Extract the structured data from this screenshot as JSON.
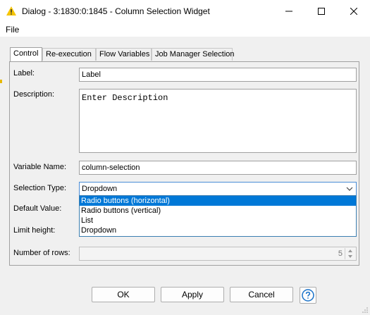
{
  "window": {
    "title": "Dialog - 3:1830:0:1845 - Column Selection Widget",
    "colors": {
      "accent": "#0078d7",
      "warning_icon": "#f5c400"
    }
  },
  "menu": {
    "file": "File"
  },
  "tabs": [
    {
      "label": "Control",
      "active": true
    },
    {
      "label": "Re-execution",
      "active": false
    },
    {
      "label": "Flow Variables",
      "active": false
    },
    {
      "label": "Job Manager Selection",
      "active": false
    }
  ],
  "form": {
    "label": {
      "label": "Label:",
      "value": "Label"
    },
    "description": {
      "label": "Description:",
      "value": "Enter Description"
    },
    "variable_name": {
      "label": "Variable Name:",
      "value": "column-selection"
    },
    "selection_type": {
      "label": "Selection Type:",
      "value": "Dropdown",
      "options": [
        "Radio buttons (horizontal)",
        "Radio buttons (vertical)",
        "List",
        "Dropdown"
      ],
      "highlighted_option": "Radio buttons (horizontal)"
    },
    "default_value": {
      "label": "Default Value:"
    },
    "limit_height": {
      "label": "Limit height:"
    },
    "number_of_rows": {
      "label": "Number of rows:",
      "value": "5"
    }
  },
  "buttons": {
    "ok": "OK",
    "apply": "Apply",
    "cancel": "Cancel"
  },
  "icons": {
    "app": "warning-triangle-icon",
    "minimize": "minimize-icon",
    "maximize": "maximize-icon",
    "close": "close-icon",
    "help": "help-icon",
    "dropdown": "chevron-down-icon"
  }
}
